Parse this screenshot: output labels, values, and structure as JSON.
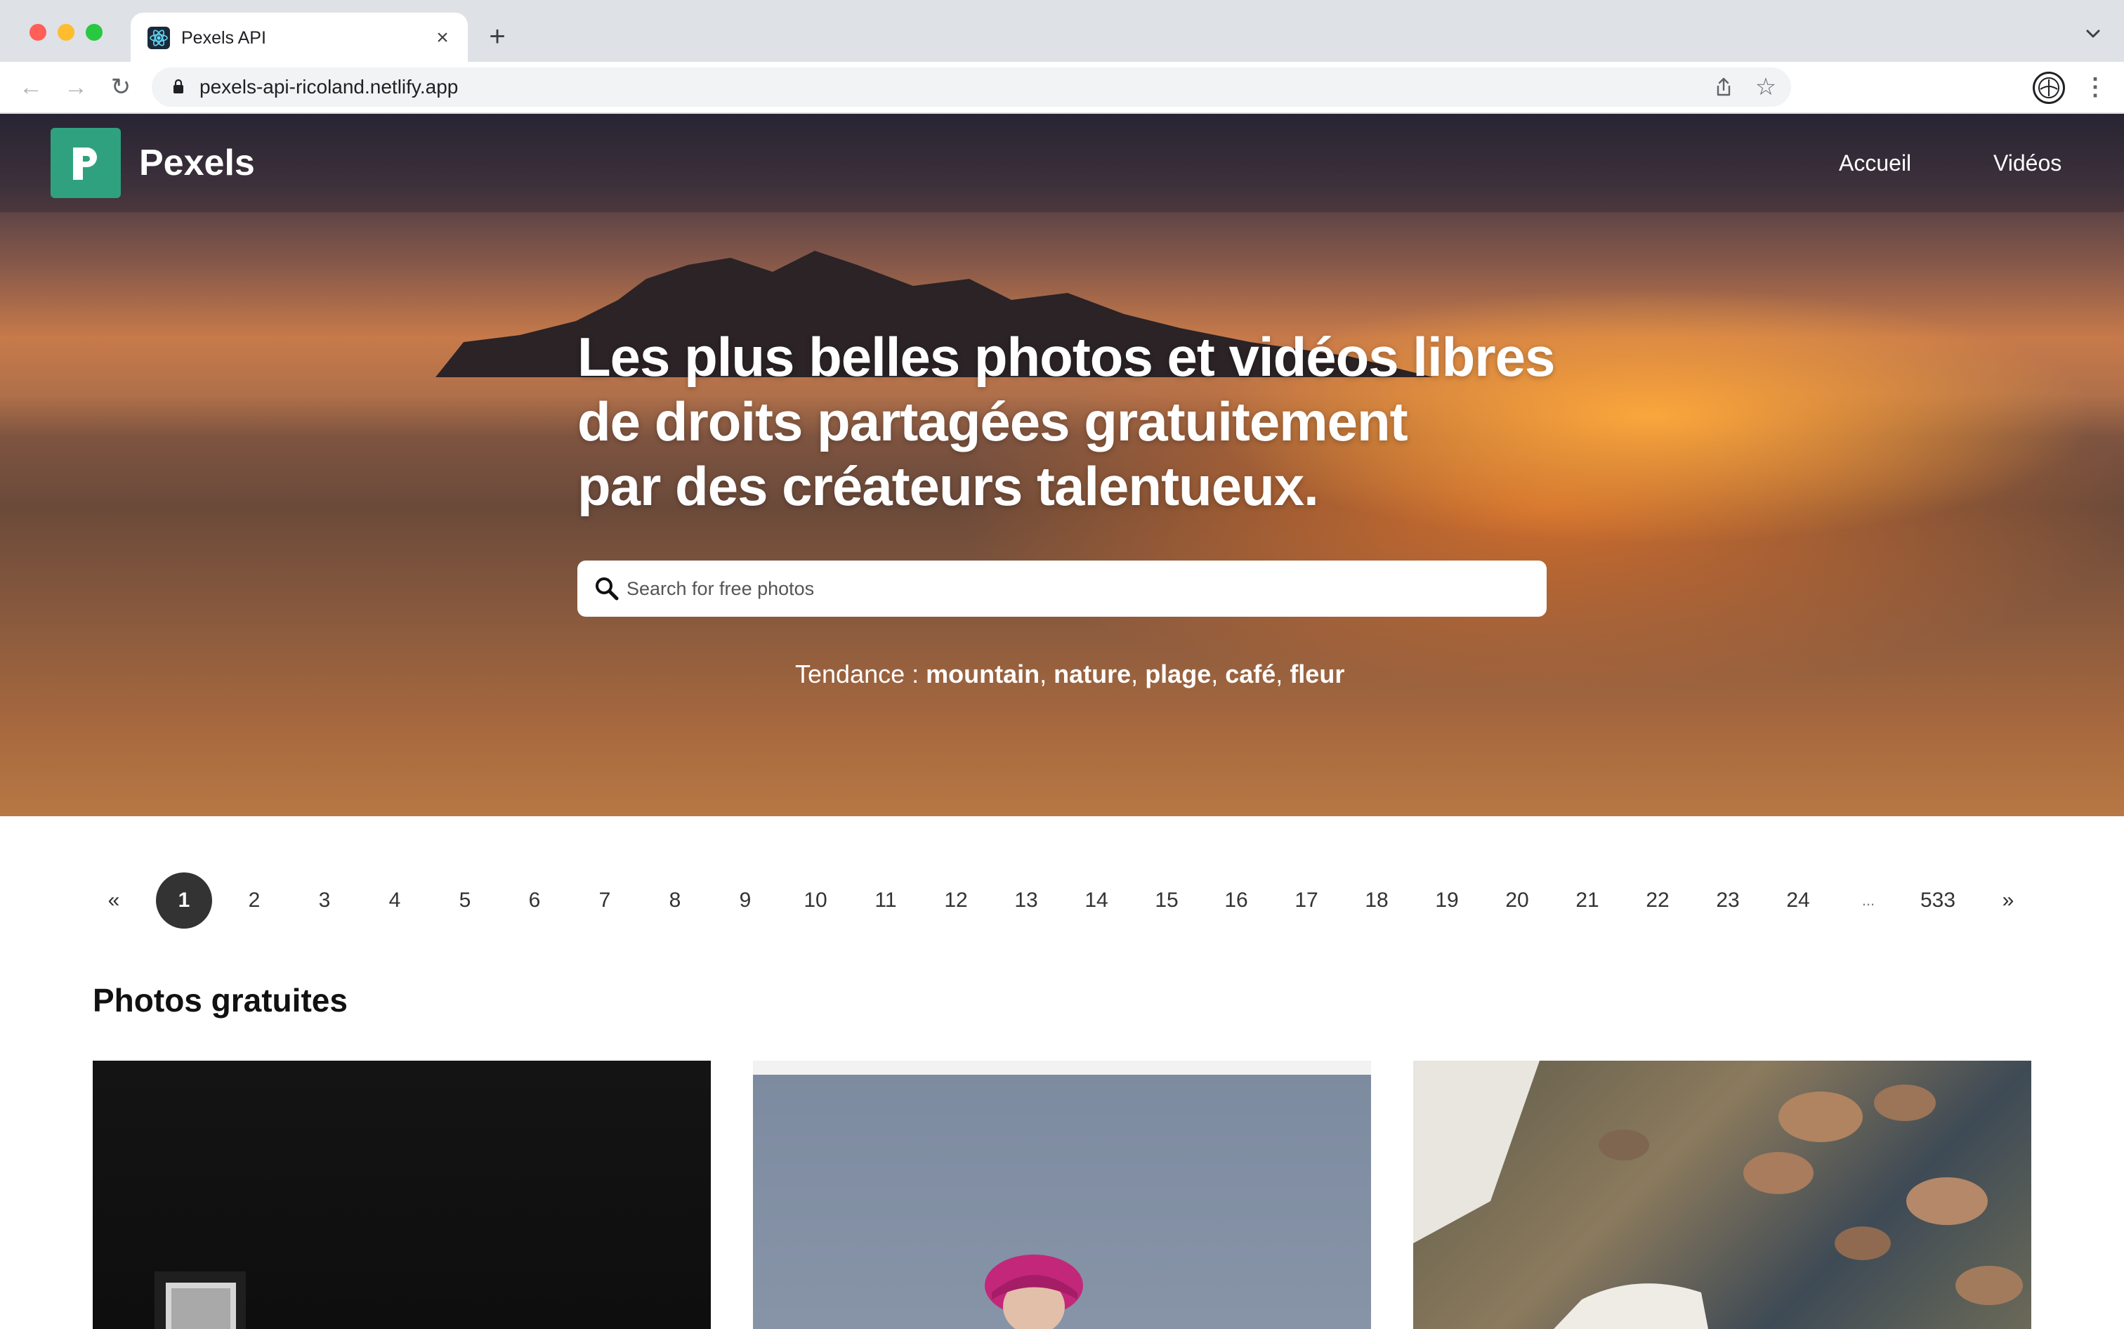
{
  "browser": {
    "tab_title": "Pexels API",
    "tab_close": "×",
    "new_tab": "+",
    "url": "pexels-api-ricoland.netlify.app",
    "nav_back": "←",
    "nav_forward": "→",
    "nav_reload": "↻",
    "star": "☆",
    "kebab": "⋮"
  },
  "site": {
    "brand": "Pexels",
    "nav": [
      "Accueil",
      "Vidéos"
    ],
    "hero_title_lines": [
      "Les plus belles photos et vidéos libres",
      "de droits partagées gratuitement",
      "par des créateurs talentueux."
    ],
    "search_placeholder": "Search for free photos",
    "trending_label": "Tendance : ",
    "trending_tags": [
      "mountain",
      "nature",
      "plage",
      "café",
      "fleur"
    ]
  },
  "pagination": {
    "prev": "«",
    "pages": [
      "1",
      "2",
      "3",
      "4",
      "5",
      "6",
      "7",
      "8",
      "9",
      "10",
      "11",
      "12",
      "13",
      "14",
      "15",
      "16",
      "17",
      "18",
      "19",
      "20",
      "21",
      "22",
      "23",
      "24"
    ],
    "ellipsis": "...",
    "last": "533",
    "next": "»",
    "active": "1"
  },
  "section_title": "Photos gratuites",
  "icons": {
    "favicon": "react-atom-icon",
    "logo": "pexels-logo-icon",
    "search": "search-icon",
    "lock": "lock-icon",
    "share": "share-icon",
    "profile": "profile-icon"
  },
  "colors": {
    "brand_green": "#2fa17f",
    "active_page": "#333333"
  }
}
